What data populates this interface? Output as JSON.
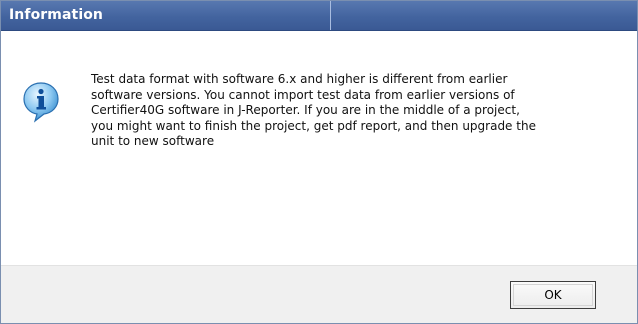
{
  "window": {
    "title": "Information"
  },
  "icon": {
    "name": "information-icon",
    "color_light": "#9fd3f5",
    "color_dark": "#2b7cc3"
  },
  "message": {
    "text": "Test data format with software 6.x and higher is different from earlier\nsoftware versions. You cannot import test data from earlier versions of\nCertifier40G software in J-Reporter. If you are in the middle of a project,\nyou might want to finish the project, get pdf report, and then upgrade the\nunit to new software"
  },
  "buttons": {
    "ok_label": "OK"
  },
  "colors": {
    "titlebar": "#43649f",
    "footer": "#f0f0f0"
  }
}
